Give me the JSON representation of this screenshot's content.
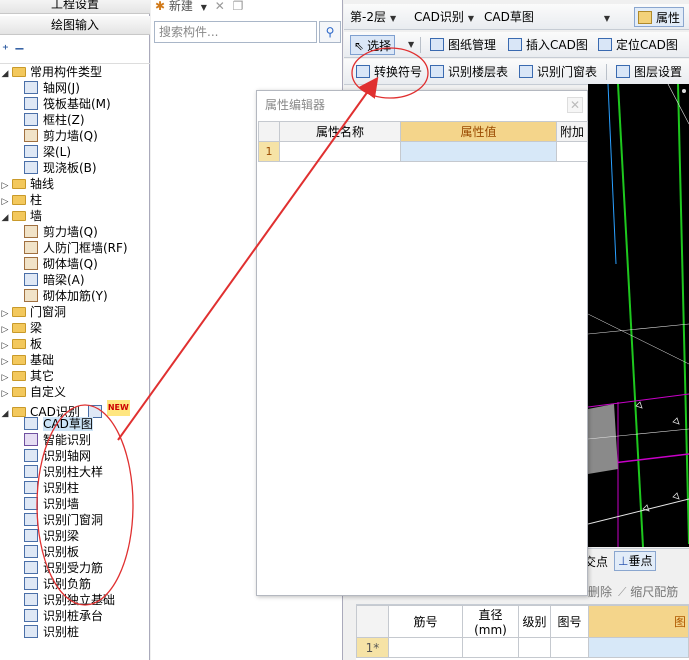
{
  "nav": {
    "project_settings": "工程设置",
    "drawing_input": "绘图输入",
    "collapse_all": "⁺",
    "expand_all": "−"
  },
  "tree": [
    {
      "indent": 0,
      "twisty": "◢",
      "icon": "folder",
      "label": "常用构件类型"
    },
    {
      "indent": 1,
      "twisty": "",
      "icon": "grid",
      "label": "轴网(J)"
    },
    {
      "indent": 1,
      "twisty": "",
      "icon": "grid",
      "label": "筏板基础(M)"
    },
    {
      "indent": 1,
      "twisty": "",
      "icon": "column",
      "label": "框柱(Z)"
    },
    {
      "indent": 1,
      "twisty": "",
      "icon": "wall",
      "label": "剪力墙(Q)"
    },
    {
      "indent": 1,
      "twisty": "",
      "icon": "beam",
      "label": "梁(L)"
    },
    {
      "indent": 1,
      "twisty": "",
      "icon": "slab",
      "label": "现浇板(B)"
    },
    {
      "indent": 0,
      "twisty": "▷",
      "icon": "folder",
      "label": "轴线"
    },
    {
      "indent": 0,
      "twisty": "▷",
      "icon": "folder",
      "label": "柱"
    },
    {
      "indent": 0,
      "twisty": "◢",
      "icon": "folder",
      "label": "墙"
    },
    {
      "indent": 1,
      "twisty": "",
      "icon": "wall",
      "label": "剪力墙(Q)"
    },
    {
      "indent": 1,
      "twisty": "",
      "icon": "wall",
      "label": "人防门框墙(RF)"
    },
    {
      "indent": 1,
      "twisty": "",
      "icon": "wall",
      "label": "砌体墙(Q)"
    },
    {
      "indent": 1,
      "twisty": "",
      "icon": "beam",
      "label": "暗梁(A)"
    },
    {
      "indent": 1,
      "twisty": "",
      "icon": "wall",
      "label": "砌体加筋(Y)"
    },
    {
      "indent": 0,
      "twisty": "▷",
      "icon": "folder",
      "label": "门窗洞"
    },
    {
      "indent": 0,
      "twisty": "▷",
      "icon": "folder",
      "label": "梁"
    },
    {
      "indent": 0,
      "twisty": "▷",
      "icon": "folder",
      "label": "板"
    },
    {
      "indent": 0,
      "twisty": "▷",
      "icon": "folder",
      "label": "基础"
    },
    {
      "indent": 0,
      "twisty": "▷",
      "icon": "folder",
      "label": "其它"
    },
    {
      "indent": 0,
      "twisty": "▷",
      "icon": "folder",
      "label": "自定义"
    },
    {
      "indent": 0,
      "twisty": "◢",
      "icon": "folder",
      "label": "CAD识别",
      "badge": "NEW"
    },
    {
      "indent": 1,
      "twisty": "",
      "icon": "cad",
      "label": "CAD草图",
      "selected": true
    },
    {
      "indent": 1,
      "twisty": "",
      "icon": "smart",
      "label": "智能识别"
    },
    {
      "indent": 1,
      "twisty": "",
      "icon": "cad",
      "label": "识别轴网"
    },
    {
      "indent": 1,
      "twisty": "",
      "icon": "cad",
      "label": "识别柱大样"
    },
    {
      "indent": 1,
      "twisty": "",
      "icon": "cad",
      "label": "识别柱"
    },
    {
      "indent": 1,
      "twisty": "",
      "icon": "cad",
      "label": "识别墙"
    },
    {
      "indent": 1,
      "twisty": "",
      "icon": "cad",
      "label": "识别门窗洞"
    },
    {
      "indent": 1,
      "twisty": "",
      "icon": "cad",
      "label": "识别梁"
    },
    {
      "indent": 1,
      "twisty": "",
      "icon": "cad",
      "label": "识别板"
    },
    {
      "indent": 1,
      "twisty": "",
      "icon": "cad",
      "label": "识别受力筋"
    },
    {
      "indent": 1,
      "twisty": "",
      "icon": "cad",
      "label": "识别负筋"
    },
    {
      "indent": 1,
      "twisty": "",
      "icon": "cad",
      "label": "识别独立基础"
    },
    {
      "indent": 1,
      "twisty": "",
      "icon": "cad",
      "label": "识别桩承台"
    },
    {
      "indent": 1,
      "twisty": "",
      "icon": "cad",
      "label": "识别桩"
    }
  ],
  "component_panel": {
    "new_label": "新建",
    "search_placeholder": "搜索构件..."
  },
  "toolbar1": {
    "floor": "第-2层",
    "mode": "CAD识别",
    "sketch": "CAD草图",
    "properties": "属性"
  },
  "toolbar2": {
    "select": "选择",
    "drawing_manage": "图纸管理",
    "insert_cad": "插入CAD图",
    "locate_cad": "定位CAD图"
  },
  "toolbar3": {
    "convert_symbol": "转换符号",
    "identify_floor_table": "识别楼层表",
    "identify_door_window_table": "识别门窗表",
    "layer_settings": "图层设置"
  },
  "property_editor": {
    "title": "属性编辑器",
    "col_name": "属性名称",
    "col_value": "属性值",
    "col_extra": "附加",
    "row_num": "1"
  },
  "bottom": {
    "intersection": "交点",
    "perpendicular": "垂点",
    "delete": "删除",
    "scale_rebar": "缩尺配筋",
    "col_rebar_no": "筋号",
    "col_diameter": "直径(mm)",
    "col_grade": "级别",
    "col_shape": "图号",
    "col_figure": "图",
    "row_new": "1*"
  }
}
